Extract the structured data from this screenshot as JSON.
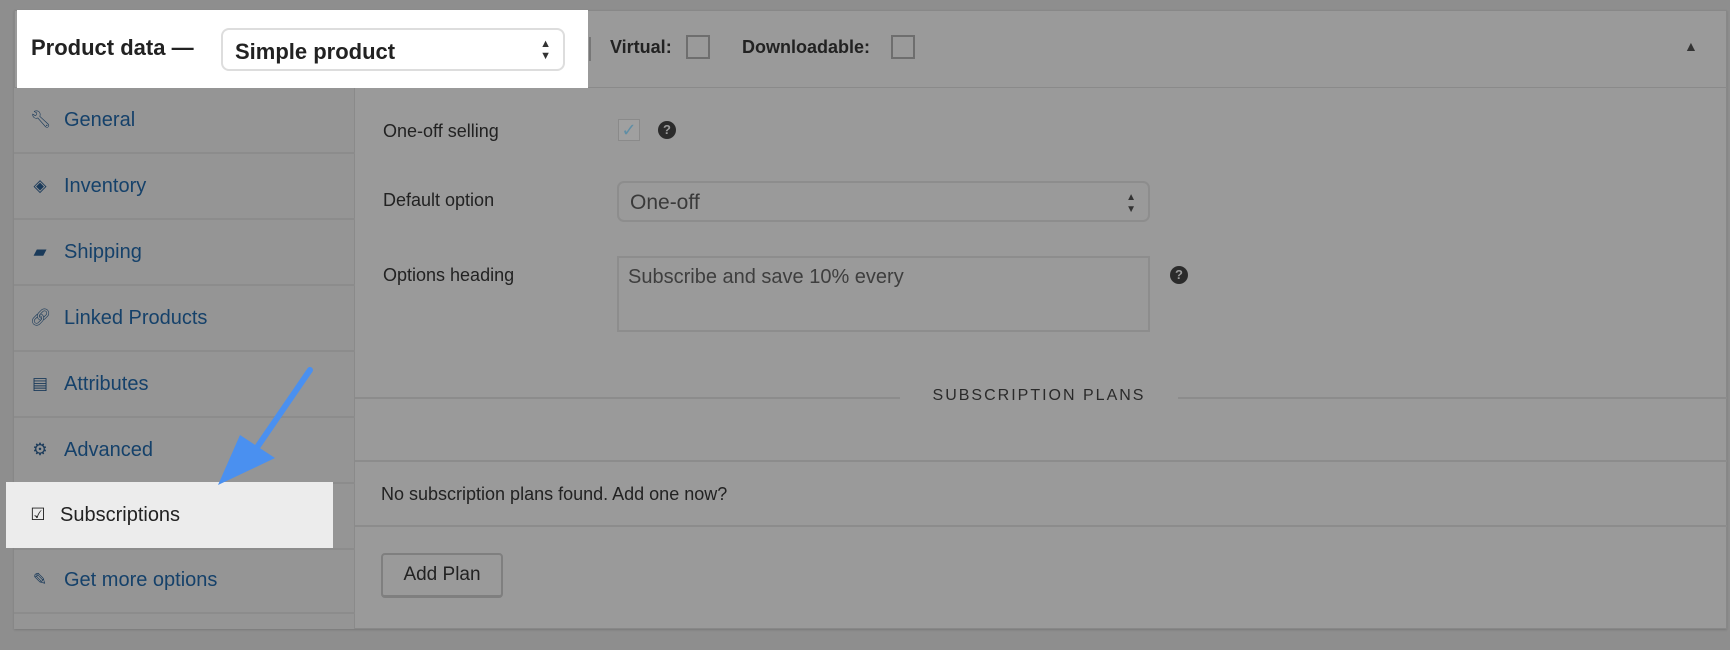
{
  "header": {
    "title": "Product data —",
    "product_type": "Simple product",
    "virtual_label": "Virtual:",
    "virtual_checked": false,
    "downloadable_label": "Downloadable:",
    "downloadable_checked": false,
    "collapse_icon": "triangle-up-icon"
  },
  "sidebar": {
    "items": [
      {
        "label": "General",
        "icon": "wrench-icon"
      },
      {
        "label": "Inventory",
        "icon": "tag-icon"
      },
      {
        "label": "Shipping",
        "icon": "truck-icon"
      },
      {
        "label": "Linked Products",
        "icon": "link-icon"
      },
      {
        "label": "Attributes",
        "icon": "list-icon"
      },
      {
        "label": "Advanced",
        "icon": "gear-icon"
      },
      {
        "label": "Subscriptions",
        "icon": "calendar-check-icon",
        "active": true
      },
      {
        "label": "Get more options",
        "icon": "plugin-icon"
      }
    ]
  },
  "main": {
    "one_off_label": "One-off selling",
    "one_off_checked": true,
    "default_option_label": "Default option",
    "default_option_value": "One-off",
    "options_heading_label": "Options heading",
    "options_heading_placeholder": "Subscribe and save 10% every",
    "plans_heading": "SUBSCRIPTION PLANS",
    "no_plans_text": "No subscription plans found. Add one now?",
    "add_plan_label": "Add Plan"
  },
  "annotation": {
    "arrow_color": "#4a90f0",
    "arrow_target": "Subscriptions"
  }
}
